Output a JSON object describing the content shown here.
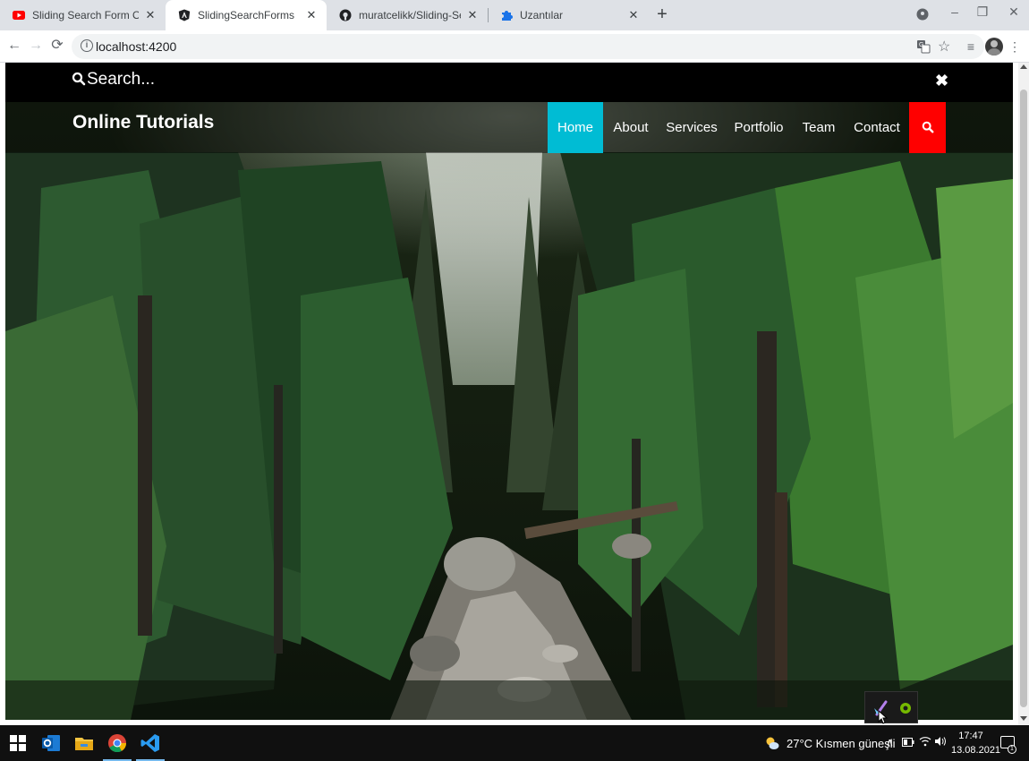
{
  "browser": {
    "tabs": [
      {
        "title": "Sliding Search Form On Click Anc",
        "icon": "youtube-icon",
        "active": false
      },
      {
        "title": "SlidingSearchForms",
        "icon": "angular-icon",
        "active": true
      },
      {
        "title": "muratcelikk/Sliding-Search-Form",
        "icon": "github-icon",
        "active": false
      },
      {
        "title": "Uzantılar",
        "icon": "puzzle-icon",
        "active": false
      }
    ],
    "tab_close_glyph": "✕",
    "new_tab_glyph": "+",
    "url": "localhost:4200",
    "info_glyph": "i"
  },
  "site": {
    "search_placeholder": "Search...",
    "search_close_glyph": "✖",
    "brand": "Online Tutorials",
    "nav": [
      "Home",
      "About",
      "Services",
      "Portfolio",
      "Team",
      "Contact"
    ],
    "active_nav": "Home",
    "accent_color": "#00bcd4",
    "search_button_color": "#ff0000"
  },
  "taskbar": {
    "weather": "27°C  Kısmen güneşli",
    "time": "17:47",
    "date": "13.08.2021",
    "notification_count": "1"
  }
}
